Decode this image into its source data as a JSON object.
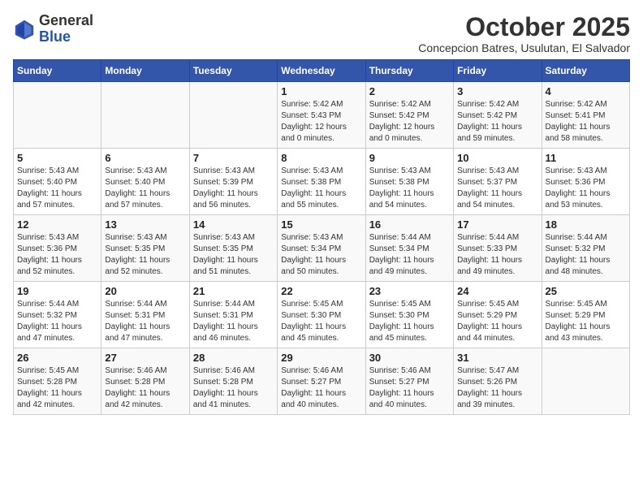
{
  "header": {
    "logo_line1": "General",
    "logo_line2": "Blue",
    "month_title": "October 2025",
    "subtitle": "Concepcion Batres, Usulutan, El Salvador"
  },
  "weekdays": [
    "Sunday",
    "Monday",
    "Tuesday",
    "Wednesday",
    "Thursday",
    "Friday",
    "Saturday"
  ],
  "weeks": [
    [
      {
        "day": "",
        "info": ""
      },
      {
        "day": "",
        "info": ""
      },
      {
        "day": "",
        "info": ""
      },
      {
        "day": "1",
        "info": "Sunrise: 5:42 AM\nSunset: 5:43 PM\nDaylight: 12 hours\nand 0 minutes."
      },
      {
        "day": "2",
        "info": "Sunrise: 5:42 AM\nSunset: 5:42 PM\nDaylight: 12 hours\nand 0 minutes."
      },
      {
        "day": "3",
        "info": "Sunrise: 5:42 AM\nSunset: 5:42 PM\nDaylight: 11 hours\nand 59 minutes."
      },
      {
        "day": "4",
        "info": "Sunrise: 5:42 AM\nSunset: 5:41 PM\nDaylight: 11 hours\nand 58 minutes."
      }
    ],
    [
      {
        "day": "5",
        "info": "Sunrise: 5:43 AM\nSunset: 5:40 PM\nDaylight: 11 hours\nand 57 minutes."
      },
      {
        "day": "6",
        "info": "Sunrise: 5:43 AM\nSunset: 5:40 PM\nDaylight: 11 hours\nand 57 minutes."
      },
      {
        "day": "7",
        "info": "Sunrise: 5:43 AM\nSunset: 5:39 PM\nDaylight: 11 hours\nand 56 minutes."
      },
      {
        "day": "8",
        "info": "Sunrise: 5:43 AM\nSunset: 5:38 PM\nDaylight: 11 hours\nand 55 minutes."
      },
      {
        "day": "9",
        "info": "Sunrise: 5:43 AM\nSunset: 5:38 PM\nDaylight: 11 hours\nand 54 minutes."
      },
      {
        "day": "10",
        "info": "Sunrise: 5:43 AM\nSunset: 5:37 PM\nDaylight: 11 hours\nand 54 minutes."
      },
      {
        "day": "11",
        "info": "Sunrise: 5:43 AM\nSunset: 5:36 PM\nDaylight: 11 hours\nand 53 minutes."
      }
    ],
    [
      {
        "day": "12",
        "info": "Sunrise: 5:43 AM\nSunset: 5:36 PM\nDaylight: 11 hours\nand 52 minutes."
      },
      {
        "day": "13",
        "info": "Sunrise: 5:43 AM\nSunset: 5:35 PM\nDaylight: 11 hours\nand 52 minutes."
      },
      {
        "day": "14",
        "info": "Sunrise: 5:43 AM\nSunset: 5:35 PM\nDaylight: 11 hours\nand 51 minutes."
      },
      {
        "day": "15",
        "info": "Sunrise: 5:43 AM\nSunset: 5:34 PM\nDaylight: 11 hours\nand 50 minutes."
      },
      {
        "day": "16",
        "info": "Sunrise: 5:44 AM\nSunset: 5:34 PM\nDaylight: 11 hours\nand 49 minutes."
      },
      {
        "day": "17",
        "info": "Sunrise: 5:44 AM\nSunset: 5:33 PM\nDaylight: 11 hours\nand 49 minutes."
      },
      {
        "day": "18",
        "info": "Sunrise: 5:44 AM\nSunset: 5:32 PM\nDaylight: 11 hours\nand 48 minutes."
      }
    ],
    [
      {
        "day": "19",
        "info": "Sunrise: 5:44 AM\nSunset: 5:32 PM\nDaylight: 11 hours\nand 47 minutes."
      },
      {
        "day": "20",
        "info": "Sunrise: 5:44 AM\nSunset: 5:31 PM\nDaylight: 11 hours\nand 47 minutes."
      },
      {
        "day": "21",
        "info": "Sunrise: 5:44 AM\nSunset: 5:31 PM\nDaylight: 11 hours\nand 46 minutes."
      },
      {
        "day": "22",
        "info": "Sunrise: 5:45 AM\nSunset: 5:30 PM\nDaylight: 11 hours\nand 45 minutes."
      },
      {
        "day": "23",
        "info": "Sunrise: 5:45 AM\nSunset: 5:30 PM\nDaylight: 11 hours\nand 45 minutes."
      },
      {
        "day": "24",
        "info": "Sunrise: 5:45 AM\nSunset: 5:29 PM\nDaylight: 11 hours\nand 44 minutes."
      },
      {
        "day": "25",
        "info": "Sunrise: 5:45 AM\nSunset: 5:29 PM\nDaylight: 11 hours\nand 43 minutes."
      }
    ],
    [
      {
        "day": "26",
        "info": "Sunrise: 5:45 AM\nSunset: 5:28 PM\nDaylight: 11 hours\nand 42 minutes."
      },
      {
        "day": "27",
        "info": "Sunrise: 5:46 AM\nSunset: 5:28 PM\nDaylight: 11 hours\nand 42 minutes."
      },
      {
        "day": "28",
        "info": "Sunrise: 5:46 AM\nSunset: 5:28 PM\nDaylight: 11 hours\nand 41 minutes."
      },
      {
        "day": "29",
        "info": "Sunrise: 5:46 AM\nSunset: 5:27 PM\nDaylight: 11 hours\nand 40 minutes."
      },
      {
        "day": "30",
        "info": "Sunrise: 5:46 AM\nSunset: 5:27 PM\nDaylight: 11 hours\nand 40 minutes."
      },
      {
        "day": "31",
        "info": "Sunrise: 5:47 AM\nSunset: 5:26 PM\nDaylight: 11 hours\nand 39 minutes."
      },
      {
        "day": "",
        "info": ""
      }
    ]
  ]
}
